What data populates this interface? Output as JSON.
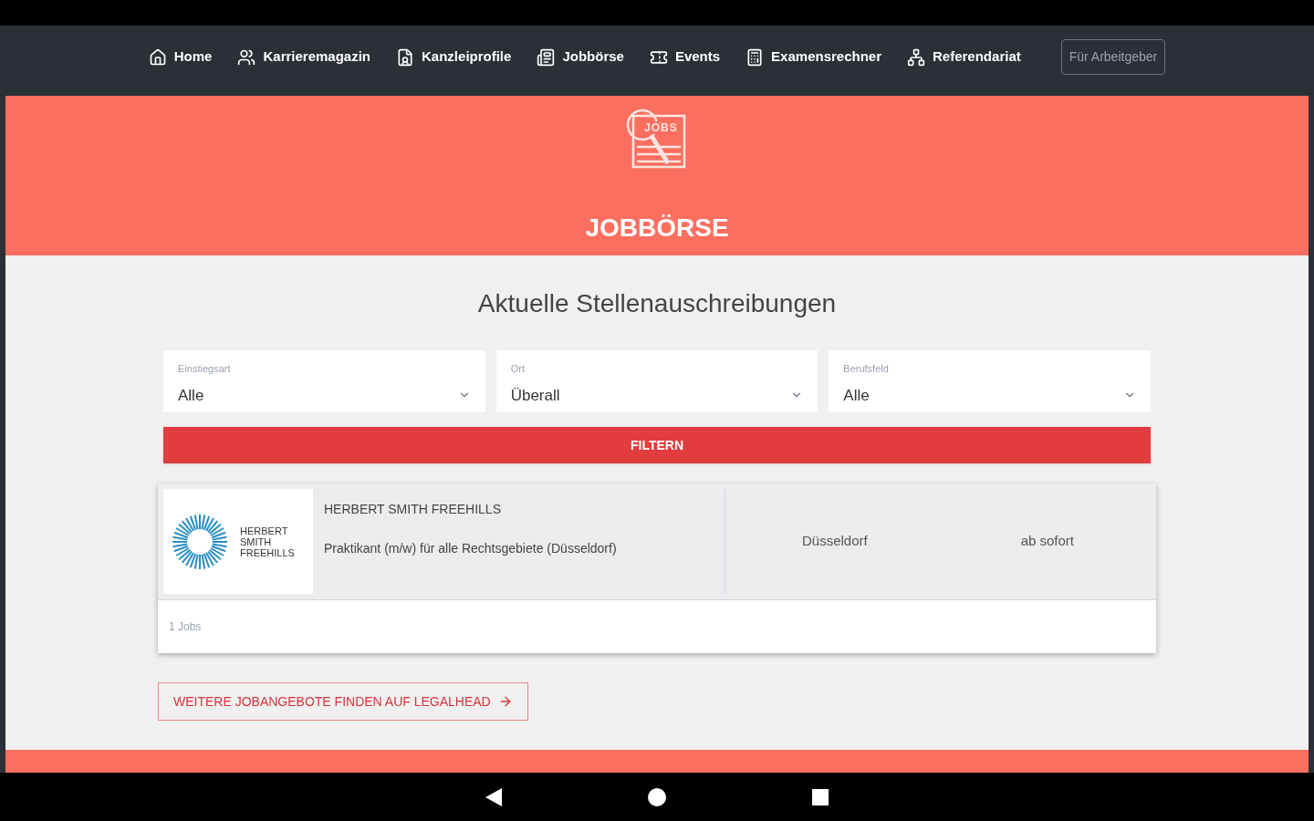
{
  "nav": {
    "items": [
      {
        "label": "Home"
      },
      {
        "label": "Karrieremagazin"
      },
      {
        "label": "Kanzleiprofile"
      },
      {
        "label": "Jobbörse"
      },
      {
        "label": "Events"
      },
      {
        "label": "Examensrechner"
      },
      {
        "label": "Referendariat"
      }
    ],
    "employer_button": "Für Arbeitgeber"
  },
  "hero": {
    "title": "JOBBÖRSE",
    "logo_text": "JOBS"
  },
  "section_title": "Aktuelle Stellenauschreibungen",
  "filters": [
    {
      "label": "Einstiegsart",
      "value": "Alle"
    },
    {
      "label": "Ort",
      "value": "Überall"
    },
    {
      "label": "Berufsfeld",
      "value": "Alle"
    }
  ],
  "filter_button": "FILTERN",
  "jobs": [
    {
      "logo_lines": [
        "HERBERT",
        "SMITH",
        "FREEHILLS"
      ],
      "company": "HERBERT SMITH FREEHILLS",
      "title": "Praktikant (m/w) für alle Rechtsgebiete (Düsseldorf)",
      "location": "Düsseldorf",
      "start": "ab sofort"
    }
  ],
  "job_count": "1 Jobs",
  "more_button": "WEITERE JOBANGEBOTE FINDEN AUF LEGALHEAD"
}
